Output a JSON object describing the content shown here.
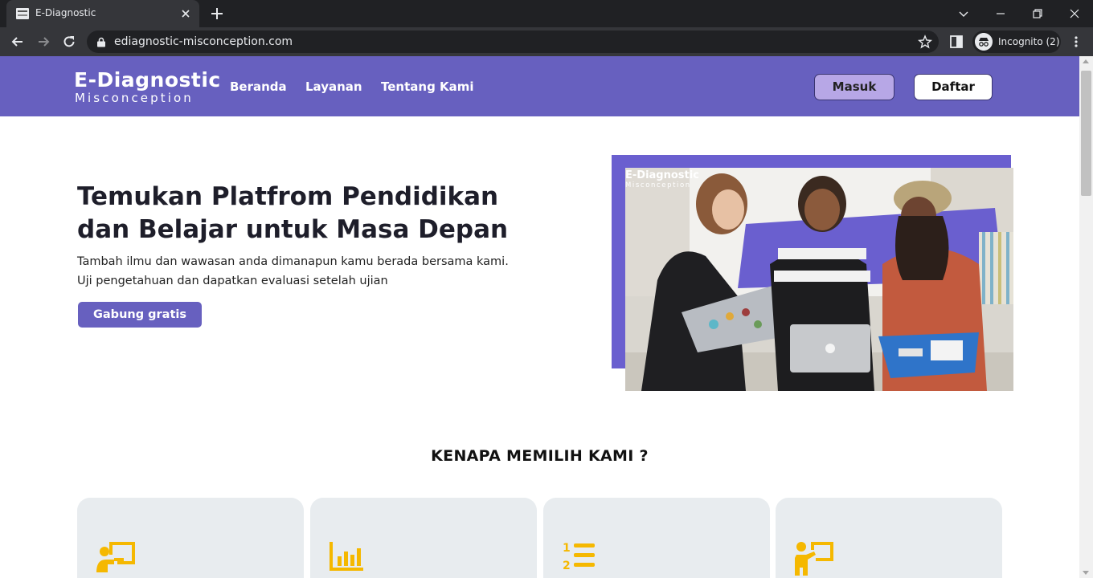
{
  "browser": {
    "tab_title": "E-Diagnostic",
    "url": "ediagnostic-misconception.com",
    "profile_label": "Incognito (2)",
    "icons": [
      "favicon",
      "close-icon",
      "plus-icon",
      "chevron-down-icon",
      "minimize-icon",
      "restore-icon",
      "window-close-icon",
      "back-arrow-icon",
      "forward-arrow-icon",
      "reload-icon",
      "lock-icon",
      "star-icon",
      "side-panel-icon",
      "incognito-icon",
      "kebab-menu-icon"
    ]
  },
  "site": {
    "logo": {
      "top": "E-Diagnostic",
      "bottom": "Misconception"
    },
    "nav": {
      "beranda": "Beranda",
      "layanan": "Layanan",
      "tentang": "Tentang Kami"
    },
    "login_label": "Masuk",
    "register_label": "Daftar",
    "brand_color": "#6760bf"
  },
  "hero": {
    "title": "Temukan Platfrom Pendidikan dan Belajar untuk Masa Depan",
    "desc_line1": "Tambah ilmu dan wawasan anda dimanapun kamu berada bersama kami.",
    "desc_line2": "Uji pengetahuan dan dapatkan evaluasi setelah ujian",
    "cta_label": "Gabung gratis",
    "image_logo": {
      "top": "E-Diagnostic",
      "bottom": "Misconception"
    }
  },
  "why": {
    "title": "KENAPA MEMILIH KAMI ?",
    "icon_color": "#f5b800",
    "card_icons": [
      "teacher-board-icon",
      "bar-chart-icon",
      "numbered-list-icon",
      "presenter-icon"
    ]
  }
}
